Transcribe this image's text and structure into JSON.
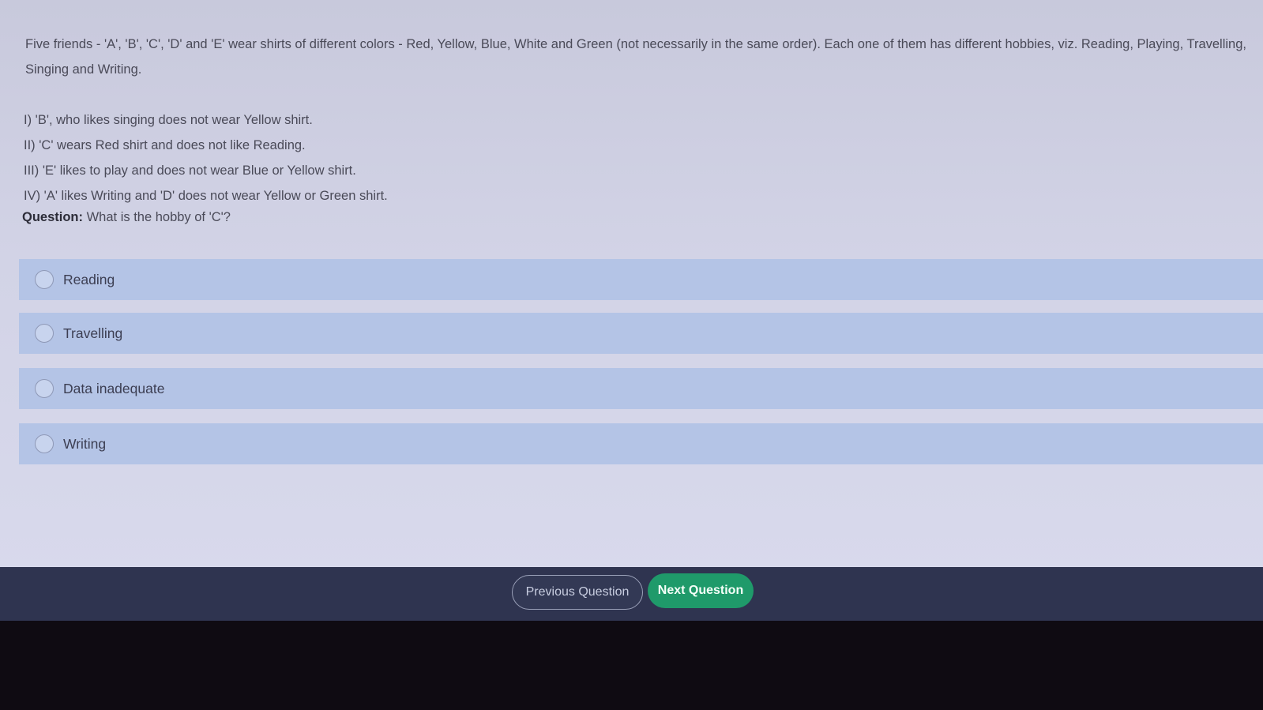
{
  "passage": "Five friends - 'A', 'B', 'C', 'D' and 'E' wear shirts of different colors - Red, Yellow, Blue, White and Green (not necessarily in the same order). Each one of them has different hobbies, viz. Reading, Playing, Travelling, Singing and Writing.",
  "clues": [
    "I) 'B', who likes singing does not wear Yellow shirt.",
    "II) 'C' wears Red shirt and does not like Reading.",
    "III) 'E' likes to play and does not wear Blue or Yellow shirt.",
    "IV) 'A' likes Writing and 'D' does not wear Yellow or Green shirt."
  ],
  "question": {
    "label": "Question:",
    "text": "What is the hobby of 'C'?"
  },
  "options": [
    {
      "label": "Reading"
    },
    {
      "label": "Travelling"
    },
    {
      "label": "Data inadequate"
    },
    {
      "label": "Writing"
    }
  ],
  "nav": {
    "previous_label": "Previous Question",
    "next_label": "Next Question"
  },
  "colors": {
    "option_bg": "#b4c4e6",
    "bar_bg": "#2f3450",
    "next_button": "#1f9a6a"
  }
}
